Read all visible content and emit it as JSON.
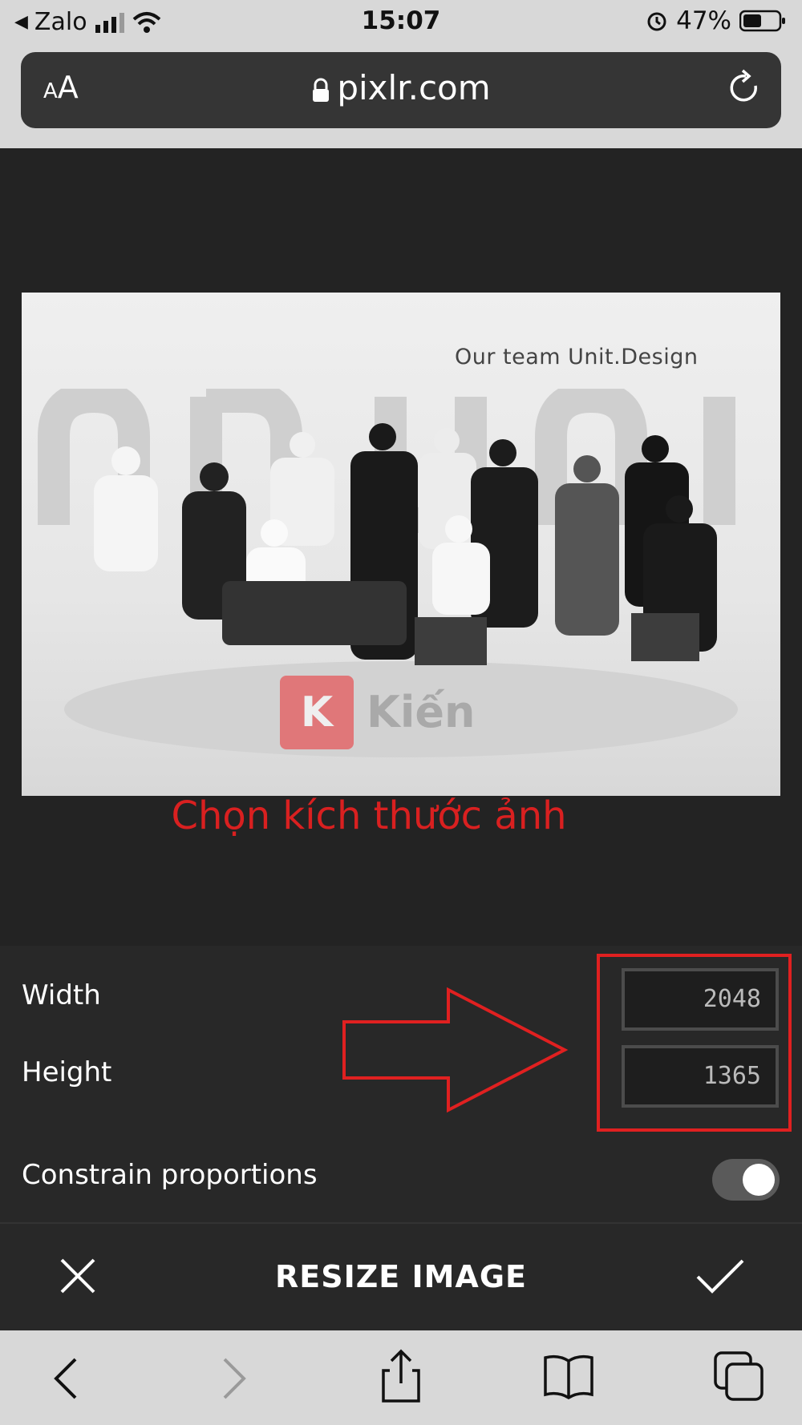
{
  "status_bar": {
    "back_app": "Zalo",
    "time": "15:07",
    "battery": "47%"
  },
  "browser": {
    "text_size_label_small": "A",
    "text_size_label": "A",
    "domain": "pixlr.com"
  },
  "photo": {
    "overlay_text": "Our team Unit.Design",
    "logo_letter": "K",
    "logo_text": "Kiến"
  },
  "annotation": {
    "caption": "Chọn kích thước ảnh",
    "color": "#d92020"
  },
  "resize_panel": {
    "width_label": "Width",
    "width_value": "2048",
    "height_label": "Height",
    "height_value": "1365",
    "constrain_label": "Constrain proportions",
    "constrain_on": true
  },
  "footer": {
    "title": "RESIZE IMAGE"
  },
  "icons": [
    "back-arrow-icon",
    "signal-icon",
    "wifi-icon",
    "alarm-icon",
    "battery-icon",
    "lock-icon",
    "reload-icon",
    "close-icon",
    "checkmark-icon",
    "nav-back-icon",
    "nav-forward-icon",
    "share-icon",
    "bookmarks-icon",
    "tabs-icon"
  ]
}
